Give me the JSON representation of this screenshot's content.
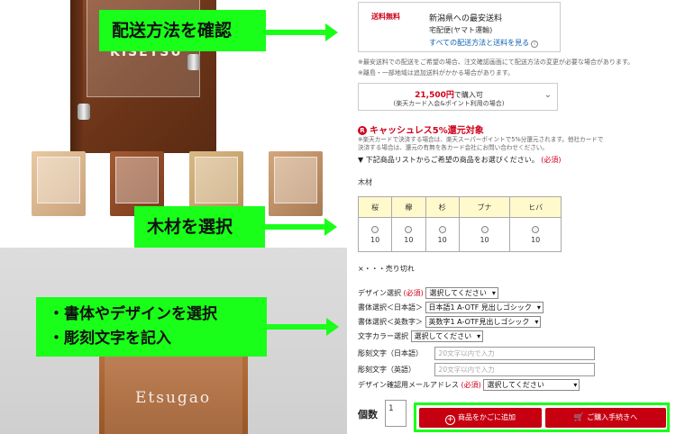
{
  "product": {
    "sign_name": "KISETSU",
    "wall_name": "Etsugao"
  },
  "callouts": {
    "shipping": "配送方法を確認",
    "wood": "木材を選択",
    "font_design": "・書体やデザインを選択",
    "engraving": "・彫刻文字を記入"
  },
  "shipping": {
    "free_label": "送料無料",
    "title": "新潟県への最安送料",
    "carrier": "宅配便(ヤマト運輸)",
    "link": "すべての配送方法と送料を見る",
    "note1": "※最安送料での配送をご希望の場合、注文確認画面にて配送方法の変更が必要な場合があります。",
    "note2": "※離島・一部地域は追加送料がかかる場合があります。"
  },
  "points": {
    "price": "21,500円",
    "suffix": "で購入可",
    "sub": "(楽天カード入会&ポイント利用の場合)"
  },
  "cashless": {
    "title": "キャッシュレス5%還元対象",
    "note1": "※楽天カードで決済する場合は、楽天スーパーポイントで5%分還元されます。他社カードで",
    "note2": "決済する場合は、還元の有無を各カード会社にお問い合わせください。"
  },
  "selection": {
    "instruction": "▼ 下記商品リストからご希望の商品をお選びください。",
    "required": "(必須)",
    "wood_label": "木材",
    "woods": [
      "桜",
      "欅",
      "杉",
      "ブナ",
      "ヒバ"
    ],
    "stock": [
      "10",
      "10",
      "10",
      "10",
      "10"
    ],
    "legend": "×・・・売り切れ"
  },
  "options": {
    "design_label": "デザイン選択",
    "design_value": "選択してください",
    "font_jp_label": "書体選択＜日本語＞",
    "font_jp_value": "日本語1 A-OTF 見出しゴシック",
    "font_en_label": "書体選択＜英数字＞",
    "font_en_value": "英数字1 A-OTF見出しゴシック",
    "color_label": "文字カラー選択",
    "color_value": "選択してください",
    "text_jp_label": "彫刻文字（日本語）",
    "text_jp_placeholder": "20文字以内で入力",
    "text_en_label": "彫刻文字（英語）",
    "text_en_placeholder": "20文字以内で入力",
    "email_label": "デザイン確認用メールアドレス",
    "email_value": "選択してください",
    "required": "(必須)"
  },
  "purchase": {
    "qty_label": "個数",
    "qty_value": "1",
    "add_cart": "商品をかごに追加",
    "buy_now": "ご購入手続きへ"
  },
  "colors": {
    "accent_red": "#c70011",
    "highlight_green": "#19ff19",
    "table_header": "#fff9cc"
  }
}
